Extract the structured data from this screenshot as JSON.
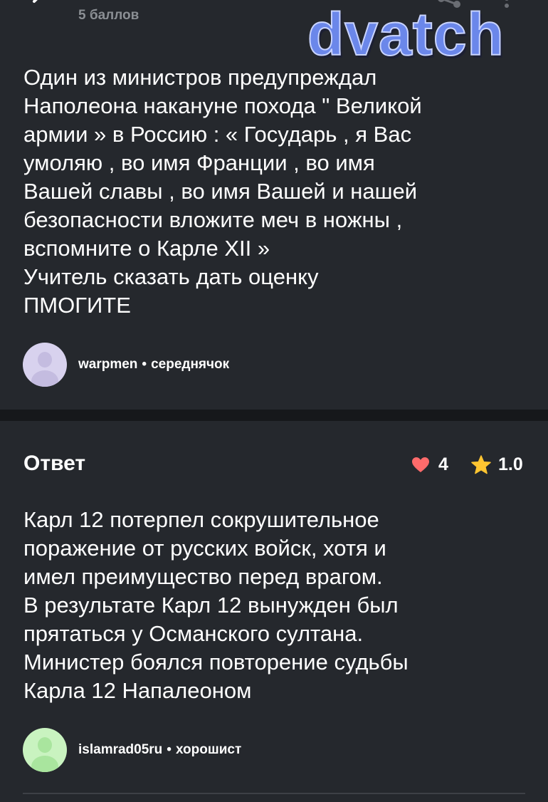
{
  "header": {
    "points_label": "5 баллов",
    "back_icon": "chevron-left-icon",
    "share_icon": "share-icon",
    "more_icon": "more-vertical-icon"
  },
  "watermark": {
    "text": "dvatch"
  },
  "question": {
    "text": "Один из министров предупреждал\nНаполеона накануне похода \" Великой\nармии » в Россию : « Государь , я Вас\nумоляю , во имя Франции , во имя\nВашей славы , во имя Вашей и нашей\nбезопасности вложите меч в ножны ,\nвспомните о Карле XII »\nУчитель сказать дать оценку\nПМОГИТЕ",
    "author": {
      "name": "warpmen",
      "separator": "•",
      "rank": "середнячок"
    }
  },
  "answer": {
    "title": "Ответ",
    "likes": "4",
    "rating": "1.0",
    "text": "Карл 12 потерпел сокрушительное\nпоражение от русских войск, хотя и\nимел преимущество перед врагом.\nВ результате Карл 12 вынужден был\nпрятаться у Османского султана.\nМинистер боялся повторение судьбы\nКарла 12 Напалеоном",
    "author": {
      "name": "islamrad05ru",
      "separator": "•",
      "rank": "хорошист"
    }
  },
  "colors": {
    "background": "#25282d",
    "heart": "#ff6b6b",
    "star": "#ffc531",
    "watermark": "#6b87ea"
  }
}
